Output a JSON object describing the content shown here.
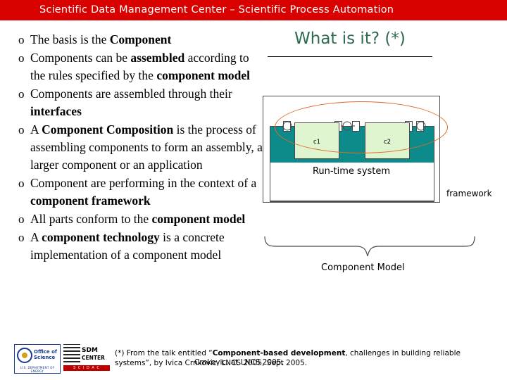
{
  "header": {
    "title": "Scientific Data Management Center – Scientific Process Automation",
    "bg_color": "#d90000",
    "text_color": "#ffffff"
  },
  "bullets": [
    {
      "marker": "o",
      "runs": [
        {
          "text": "The basis is the ",
          "bold": false
        },
        {
          "text": "Component",
          "bold": true
        }
      ]
    },
    {
      "marker": "o",
      "runs": [
        {
          "text": "Components can be ",
          "bold": false
        },
        {
          "text": "assembled",
          "bold": true
        },
        {
          "text": " according to the rules specified by the ",
          "bold": false
        },
        {
          "text": "component model",
          "bold": true
        }
      ]
    },
    {
      "marker": "o",
      "runs": [
        {
          "text": "Components are assembled through their ",
          "bold": false
        },
        {
          "text": "interfaces",
          "bold": true
        }
      ]
    },
    {
      "marker": "o",
      "runs": [
        {
          "text": "A ",
          "bold": false
        },
        {
          "text": "Component Composition",
          "bold": true
        },
        {
          "text": " is the process of assembling components to form an assembly, a larger component or an application",
          "bold": false
        }
      ]
    },
    {
      "marker": "o",
      "runs": [
        {
          "text": "Component are performing in the context of a ",
          "bold": false
        },
        {
          "text": "component framework",
          "bold": true
        }
      ]
    },
    {
      "marker": "o",
      "runs": [
        {
          "text": "All parts conform to the ",
          "bold": false
        },
        {
          "text": "component model",
          "bold": true
        }
      ]
    },
    {
      "marker": "o",
      "runs": [
        {
          "text": "A ",
          "bold": false
        },
        {
          "text": "component technology",
          "bold": true
        },
        {
          "text": " is a concrete implementation of a component model",
          "bold": false
        }
      ]
    }
  ],
  "right_panel": {
    "heading": "What is it? (*)",
    "heading_color": "#2d6b4f",
    "diagram": {
      "runtime_label": "Run-time system",
      "framework_label": "framework",
      "component_model_label": "Component Model",
      "components": [
        {
          "label": "c1"
        },
        {
          "label": "c2"
        }
      ],
      "oval_color": "#e06a2a",
      "runtime_fill": "#0d8a8a",
      "component_fill": "#dff5d0"
    }
  },
  "footer": {
    "note_runs": [
      {
        "text": "(*) From the talk entitled “",
        "bold": false
      },
      {
        "text": "Component-based development",
        "bold": true
      },
      {
        "text": ", challenges in building reliable systems”, by Ivica Crnkovic, LNCS 2005, Sept 2005.",
        "bold": false
      }
    ],
    "overlap_text": "Crnkovic, at LNCS 2005."
  },
  "logos": {
    "doe": {
      "line1": "Office of",
      "line2": "Science",
      "bottom": "U.S. DEPARTMENT OF ENERGY"
    },
    "sdm": {
      "line1": "SDM",
      "line2": "CENTER",
      "bar": "S C I D A C"
    }
  }
}
